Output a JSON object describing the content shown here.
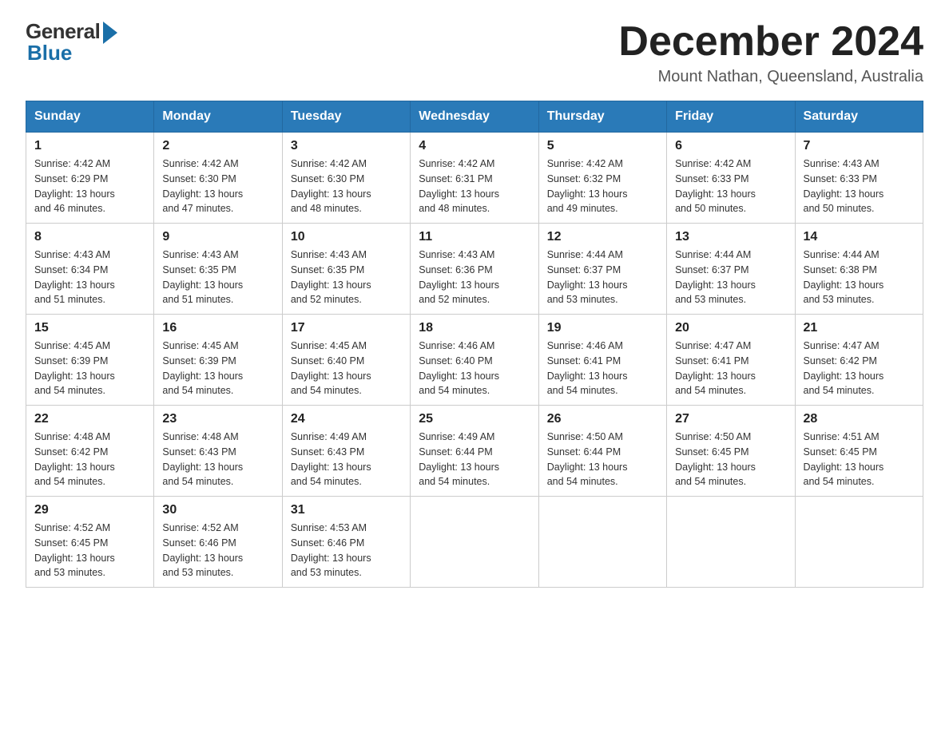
{
  "header": {
    "title": "December 2024",
    "location": "Mount Nathan, Queensland, Australia",
    "logo_general": "General",
    "logo_blue": "Blue"
  },
  "days_of_week": [
    "Sunday",
    "Monday",
    "Tuesday",
    "Wednesday",
    "Thursday",
    "Friday",
    "Saturday"
  ],
  "weeks": [
    [
      {
        "day": 1,
        "sunrise": "4:42 AM",
        "sunset": "6:29 PM",
        "daylight": "13 hours and 46 minutes."
      },
      {
        "day": 2,
        "sunrise": "4:42 AM",
        "sunset": "6:30 PM",
        "daylight": "13 hours and 47 minutes."
      },
      {
        "day": 3,
        "sunrise": "4:42 AM",
        "sunset": "6:30 PM",
        "daylight": "13 hours and 48 minutes."
      },
      {
        "day": 4,
        "sunrise": "4:42 AM",
        "sunset": "6:31 PM",
        "daylight": "13 hours and 48 minutes."
      },
      {
        "day": 5,
        "sunrise": "4:42 AM",
        "sunset": "6:32 PM",
        "daylight": "13 hours and 49 minutes."
      },
      {
        "day": 6,
        "sunrise": "4:42 AM",
        "sunset": "6:33 PM",
        "daylight": "13 hours and 50 minutes."
      },
      {
        "day": 7,
        "sunrise": "4:43 AM",
        "sunset": "6:33 PM",
        "daylight": "13 hours and 50 minutes."
      }
    ],
    [
      {
        "day": 8,
        "sunrise": "4:43 AM",
        "sunset": "6:34 PM",
        "daylight": "13 hours and 51 minutes."
      },
      {
        "day": 9,
        "sunrise": "4:43 AM",
        "sunset": "6:35 PM",
        "daylight": "13 hours and 51 minutes."
      },
      {
        "day": 10,
        "sunrise": "4:43 AM",
        "sunset": "6:35 PM",
        "daylight": "13 hours and 52 minutes."
      },
      {
        "day": 11,
        "sunrise": "4:43 AM",
        "sunset": "6:36 PM",
        "daylight": "13 hours and 52 minutes."
      },
      {
        "day": 12,
        "sunrise": "4:44 AM",
        "sunset": "6:37 PM",
        "daylight": "13 hours and 53 minutes."
      },
      {
        "day": 13,
        "sunrise": "4:44 AM",
        "sunset": "6:37 PM",
        "daylight": "13 hours and 53 minutes."
      },
      {
        "day": 14,
        "sunrise": "4:44 AM",
        "sunset": "6:38 PM",
        "daylight": "13 hours and 53 minutes."
      }
    ],
    [
      {
        "day": 15,
        "sunrise": "4:45 AM",
        "sunset": "6:39 PM",
        "daylight": "13 hours and 54 minutes."
      },
      {
        "day": 16,
        "sunrise": "4:45 AM",
        "sunset": "6:39 PM",
        "daylight": "13 hours and 54 minutes."
      },
      {
        "day": 17,
        "sunrise": "4:45 AM",
        "sunset": "6:40 PM",
        "daylight": "13 hours and 54 minutes."
      },
      {
        "day": 18,
        "sunrise": "4:46 AM",
        "sunset": "6:40 PM",
        "daylight": "13 hours and 54 minutes."
      },
      {
        "day": 19,
        "sunrise": "4:46 AM",
        "sunset": "6:41 PM",
        "daylight": "13 hours and 54 minutes."
      },
      {
        "day": 20,
        "sunrise": "4:47 AM",
        "sunset": "6:41 PM",
        "daylight": "13 hours and 54 minutes."
      },
      {
        "day": 21,
        "sunrise": "4:47 AM",
        "sunset": "6:42 PM",
        "daylight": "13 hours and 54 minutes."
      }
    ],
    [
      {
        "day": 22,
        "sunrise": "4:48 AM",
        "sunset": "6:42 PM",
        "daylight": "13 hours and 54 minutes."
      },
      {
        "day": 23,
        "sunrise": "4:48 AM",
        "sunset": "6:43 PM",
        "daylight": "13 hours and 54 minutes."
      },
      {
        "day": 24,
        "sunrise": "4:49 AM",
        "sunset": "6:43 PM",
        "daylight": "13 hours and 54 minutes."
      },
      {
        "day": 25,
        "sunrise": "4:49 AM",
        "sunset": "6:44 PM",
        "daylight": "13 hours and 54 minutes."
      },
      {
        "day": 26,
        "sunrise": "4:50 AM",
        "sunset": "6:44 PM",
        "daylight": "13 hours and 54 minutes."
      },
      {
        "day": 27,
        "sunrise": "4:50 AM",
        "sunset": "6:45 PM",
        "daylight": "13 hours and 54 minutes."
      },
      {
        "day": 28,
        "sunrise": "4:51 AM",
        "sunset": "6:45 PM",
        "daylight": "13 hours and 54 minutes."
      }
    ],
    [
      {
        "day": 29,
        "sunrise": "4:52 AM",
        "sunset": "6:45 PM",
        "daylight": "13 hours and 53 minutes."
      },
      {
        "day": 30,
        "sunrise": "4:52 AM",
        "sunset": "6:46 PM",
        "daylight": "13 hours and 53 minutes."
      },
      {
        "day": 31,
        "sunrise": "4:53 AM",
        "sunset": "6:46 PM",
        "daylight": "13 hours and 53 minutes."
      },
      null,
      null,
      null,
      null
    ]
  ],
  "labels": {
    "sunrise": "Sunrise:",
    "sunset": "Sunset:",
    "daylight": "Daylight:"
  }
}
